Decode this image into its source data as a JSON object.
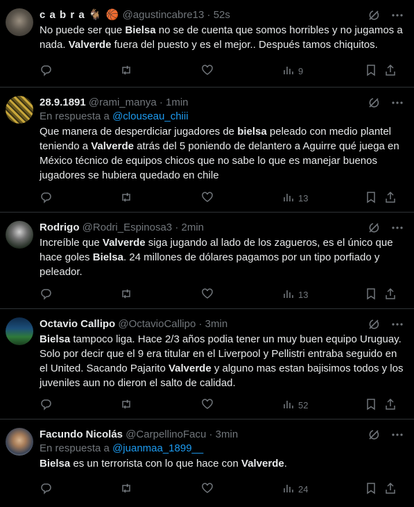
{
  "tweets": [
    {
      "name": "c a b r a 🐐 🏀",
      "handle": "@agustincabre13",
      "time": "52s",
      "reply_to": "",
      "text_parts": [
        {
          "t": "No puede ser que ",
          "b": false
        },
        {
          "t": "Bielsa",
          "b": true
        },
        {
          "t": " no se de cuenta que somos horribles y no jugamos a nada. ",
          "b": false
        },
        {
          "t": "Valverde",
          "b": true
        },
        {
          "t": " fuera del puesto y es el mejor.. Después tamos chiquitos.",
          "b": false
        }
      ],
      "views": "9"
    },
    {
      "name": "28.9.1891",
      "handle": "@rami_manya",
      "time": "1min",
      "reply_to": "@clouseau_chiii",
      "text_parts": [
        {
          "t": "Que manera de desperdiciar jugadores de ",
          "b": false
        },
        {
          "t": "bielsa",
          "b": true
        },
        {
          "t": " peleado con medio plantel teniendo a ",
          "b": false
        },
        {
          "t": "Valverde",
          "b": true
        },
        {
          "t": " atrás del 5 poniendo de delantero a Aguirre qué juega en México técnico de equipos chicos que no sabe lo que es manejar buenos jugadores se hubiera quedado en chile",
          "b": false
        }
      ],
      "views": "13"
    },
    {
      "name": "Rodrigo",
      "handle": "@Rodri_Espinosa3",
      "time": "2min",
      "reply_to": "",
      "text_parts": [
        {
          "t": "Increíble que ",
          "b": false
        },
        {
          "t": "Valverde",
          "b": true
        },
        {
          "t": " siga jugando al lado de los zagueros, es el único que hace goles ",
          "b": false
        },
        {
          "t": "Bielsa",
          "b": true
        },
        {
          "t": ". 24 millones de dólares pagamos por un tipo porfiado y peleador.",
          "b": false
        }
      ],
      "views": "13"
    },
    {
      "name": "Octavio Callipo",
      "handle": "@OctavioCallipo",
      "time": "3min",
      "reply_to": "",
      "text_parts": [
        {
          "t": "Bielsa",
          "b": true
        },
        {
          "t": " tampoco liga. Hace 2/3 años podia tener un muy buen equipo Uruguay. Solo por decir que el 9 era titular en el Liverpool y Pellistri entraba seguido en el United. Sacando Pajarito ",
          "b": false
        },
        {
          "t": "Valverde",
          "b": true
        },
        {
          "t": " y alguno mas estan bajisimos todos y los juveniles aun no dieron el salto de calidad.",
          "b": false
        }
      ],
      "views": "52"
    },
    {
      "name": "Facundo Nicolás",
      "handle": "@CarpellinoFacu",
      "time": "3min",
      "reply_to": "@juanmaa_1899__",
      "text_parts": [
        {
          "t": "Bielsa",
          "b": true
        },
        {
          "t": " es un terrorista con lo que hace con ",
          "b": false
        },
        {
          "t": "Valverde",
          "b": true
        },
        {
          "t": ".",
          "b": false
        }
      ],
      "views": "24"
    }
  ],
  "ui": {
    "reply_prefix": "En respuesta a",
    "separator": "·"
  },
  "colors": {
    "background": "#000000",
    "text": "#e7e9ea",
    "secondary": "#71767b",
    "link": "#1d9bf0",
    "border": "#2f3336"
  }
}
